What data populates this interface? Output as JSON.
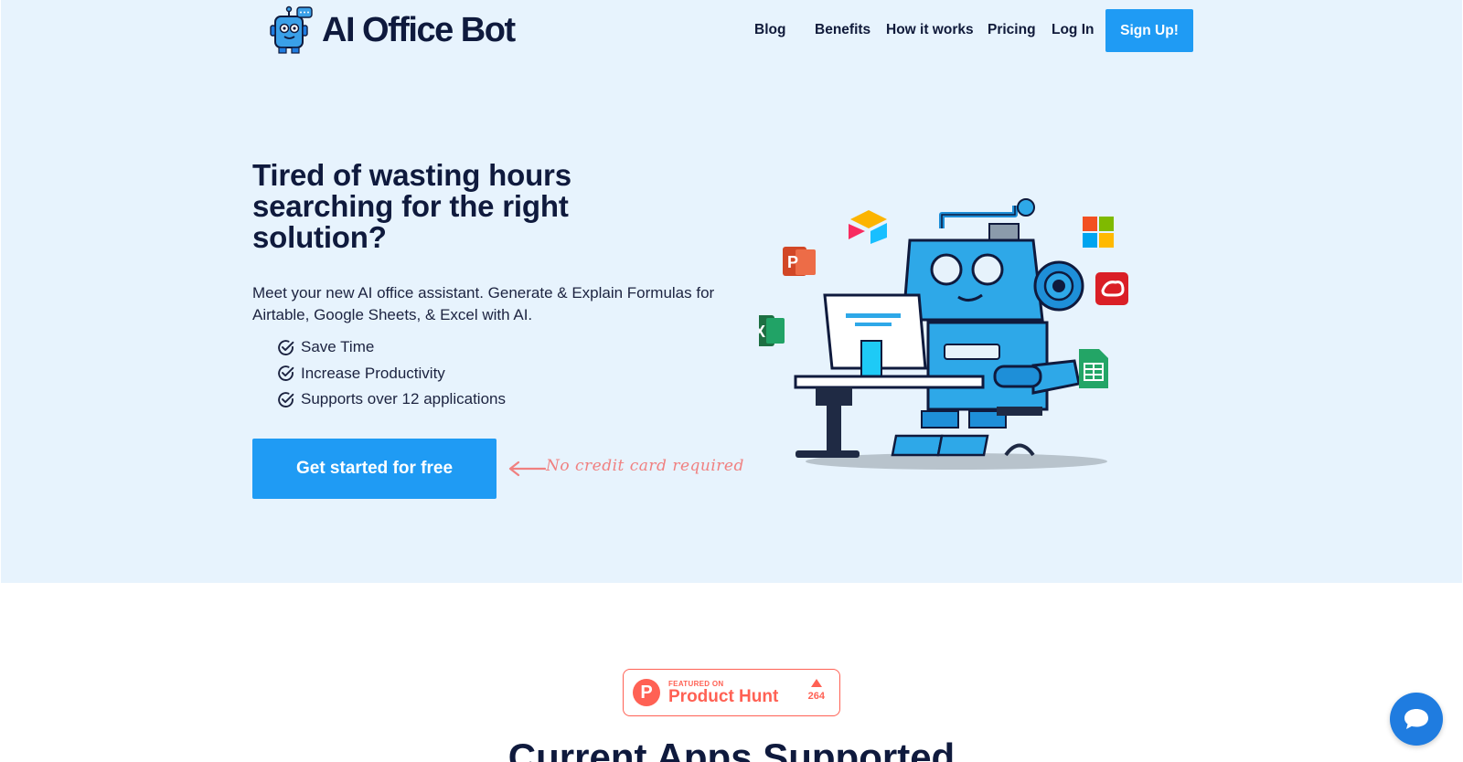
{
  "header": {
    "brand": "AI Office Bot",
    "nav": [
      "Blog",
      "Benefits",
      "How it works",
      "Pricing",
      "Log In"
    ],
    "signup_label": "Sign Up!"
  },
  "hero": {
    "headline": "Tired of wasting hours searching for the right solution?",
    "subhead": "Meet your new AI office assistant. Generate & Explain Formulas for Airtable, Google Sheets, & Excel with AI.",
    "features": [
      "Save Time",
      "Increase Productivity",
      "Supports over 12 applications"
    ],
    "cta_label": "Get started for free",
    "cta_note": "No credit card required"
  },
  "product_hunt": {
    "featured_on": "FEATURED ON",
    "name": "Product Hunt",
    "votes": "264"
  },
  "section": {
    "title": "Current Apps Supported"
  },
  "icons": {
    "chat": "chat-bubble-icon",
    "check": "check-circle-icon"
  },
  "colors": {
    "accent": "#1f9bf4",
    "hero_bg": "#e7f3fd",
    "product_hunt": "#ff6154",
    "note": "#f08080"
  }
}
